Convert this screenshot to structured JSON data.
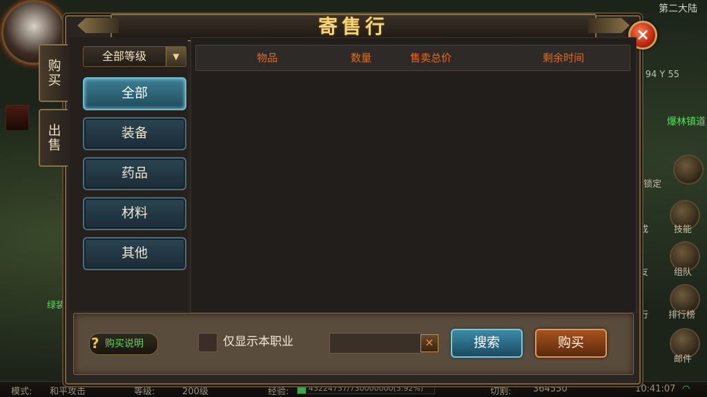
{
  "hud": {
    "region": "第二大陆",
    "coords": "94 Y 55",
    "npc_name": "爆林镇道",
    "side_labels": [
      "锁定",
      "技能",
      "组队",
      "排行榜",
      "邮件"
    ],
    "side_labels_partial": [
      "成",
      "友",
      "行"
    ],
    "left_label": "绿装"
  },
  "statusbar": {
    "mode_label": "模式:",
    "mode_value": "和平攻击",
    "level_label": "等级:",
    "level_value": "200级",
    "exp_label": "经验:",
    "exp_value": "43224757/730000000(5.92%)",
    "exp_fraction": 0.0592,
    "cut_label": "切割:",
    "cut_value": "364550",
    "time": "10:41:07"
  },
  "dialog": {
    "title": "寄售行",
    "close_glyph": "×",
    "tabs": [
      {
        "label": "购买",
        "active": true
      },
      {
        "label": "出售",
        "active": false
      }
    ],
    "grade_select": {
      "label": "全部等级",
      "arrow": "▼"
    },
    "categories": [
      {
        "label": "全部",
        "active": true
      },
      {
        "label": "装备",
        "active": false
      },
      {
        "label": "药品",
        "active": false
      },
      {
        "label": "材料",
        "active": false
      },
      {
        "label": "其他",
        "active": false
      }
    ],
    "columns": [
      "物品",
      "数量",
      "售卖总价",
      "剩余时间"
    ],
    "rows": [],
    "help": {
      "icon": "?",
      "label": "购买说明"
    },
    "filter_label": "仅显示本职业",
    "search_value": "",
    "clear_glyph": "×",
    "search_button": "搜索",
    "buy_button": "购买"
  },
  "colors": {
    "header_text": "#e86a1a",
    "title_gold": "#f2d67a",
    "help_green": "#55e04a"
  }
}
